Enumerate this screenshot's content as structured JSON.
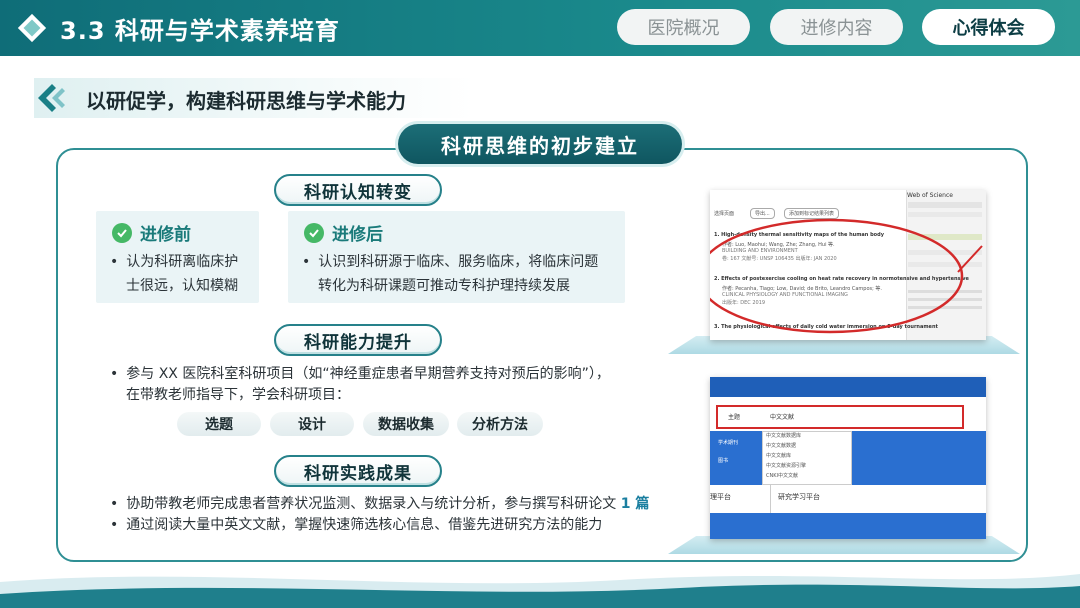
{
  "header": {
    "title": "3.3 科研与学术素养培育",
    "nav": [
      {
        "label": "医院概况",
        "active": false
      },
      {
        "label": "进修内容",
        "active": false
      },
      {
        "label": "心得体会",
        "active": true
      }
    ]
  },
  "subheading": "以研促学，构建科研思维与学术能力",
  "panel": {
    "title": "科研思维的初步建立",
    "section1": {
      "title": "科研认知转变",
      "before": {
        "label": "进修前",
        "line1": "认为科研离临床护",
        "line2": "士很远，认知模糊"
      },
      "after": {
        "label": "进修后",
        "line1": "认识到科研源于临床、服务临床，将临床问题",
        "line2": "转化为科研课题可推动专科护理持续发展"
      }
    },
    "section2": {
      "title": "科研能力提升",
      "line1": "参与 XX 医院科室科研项目（如“神经重症患者早期营养支持对预后的影响”），",
      "line2": "在带教老师指导下，学会科研项目：",
      "tags": [
        "选题",
        "设计",
        "数据收集",
        "分析方法"
      ]
    },
    "section3": {
      "title": "科研实践成果",
      "bullet1_text": "协助带教老师完成患者营养状况监测、数据录入与统计分析，参与撰写科研论文",
      "bullet1_highlight": "1 篇",
      "bullet2": "通过阅读大量中英文文献，掌握快速筛选核心信息、借鉴先进研究方法的能力"
    }
  },
  "screenshot1": {
    "site": "Web of Science",
    "toolbar": [
      "导出...",
      "添加到标记结果列表"
    ],
    "results_label": "选择页面",
    "item1": {
      "num": "1.",
      "title": "High-density thermal sensitivity maps of the human body",
      "authors": "作者: Luo, Maohui; Wang, Zhe; Zhang, Hui 等.",
      "journal": "BUILDING AND ENVIRONMENT",
      "meta": "卷: 167  文献号: UNSP 106435  出版年: JAN 2020"
    },
    "item2": {
      "num": "2.",
      "title": "Effects of postexercise cooling on heat rate recovery in normotensive and hypertensive",
      "authors": "作者: Pecanha, Tiago; Low, David; de Brito, Leandro Campos; 等.",
      "journal": "CLINICAL PHYSIOLOGY AND FUNCTIONAL IMAGING",
      "meta": "出版年: DEC 2019"
    },
    "item3": {
      "num": "3.",
      "title": "The physiological effects of daily cold water immersion on 5-day tournament"
    }
  },
  "screenshot2": {
    "dropdown_label": "主题",
    "dropdown_value": "中文文献",
    "menu_items": [
      "中文文献数据库",
      "中文文献数据",
      "中文文献库",
      "中文文献资源引擎",
      "CNKI中文文献"
    ],
    "sidebar_items": [
      "学术期刊",
      "图书"
    ],
    "footer_left": "理平台",
    "footer_right": "研究学习平台"
  },
  "colors": {
    "teal": "#1a8a8c",
    "dark_teal": "#0f5660",
    "check_green": "#45b866",
    "highlight": "#1b7fa0"
  }
}
